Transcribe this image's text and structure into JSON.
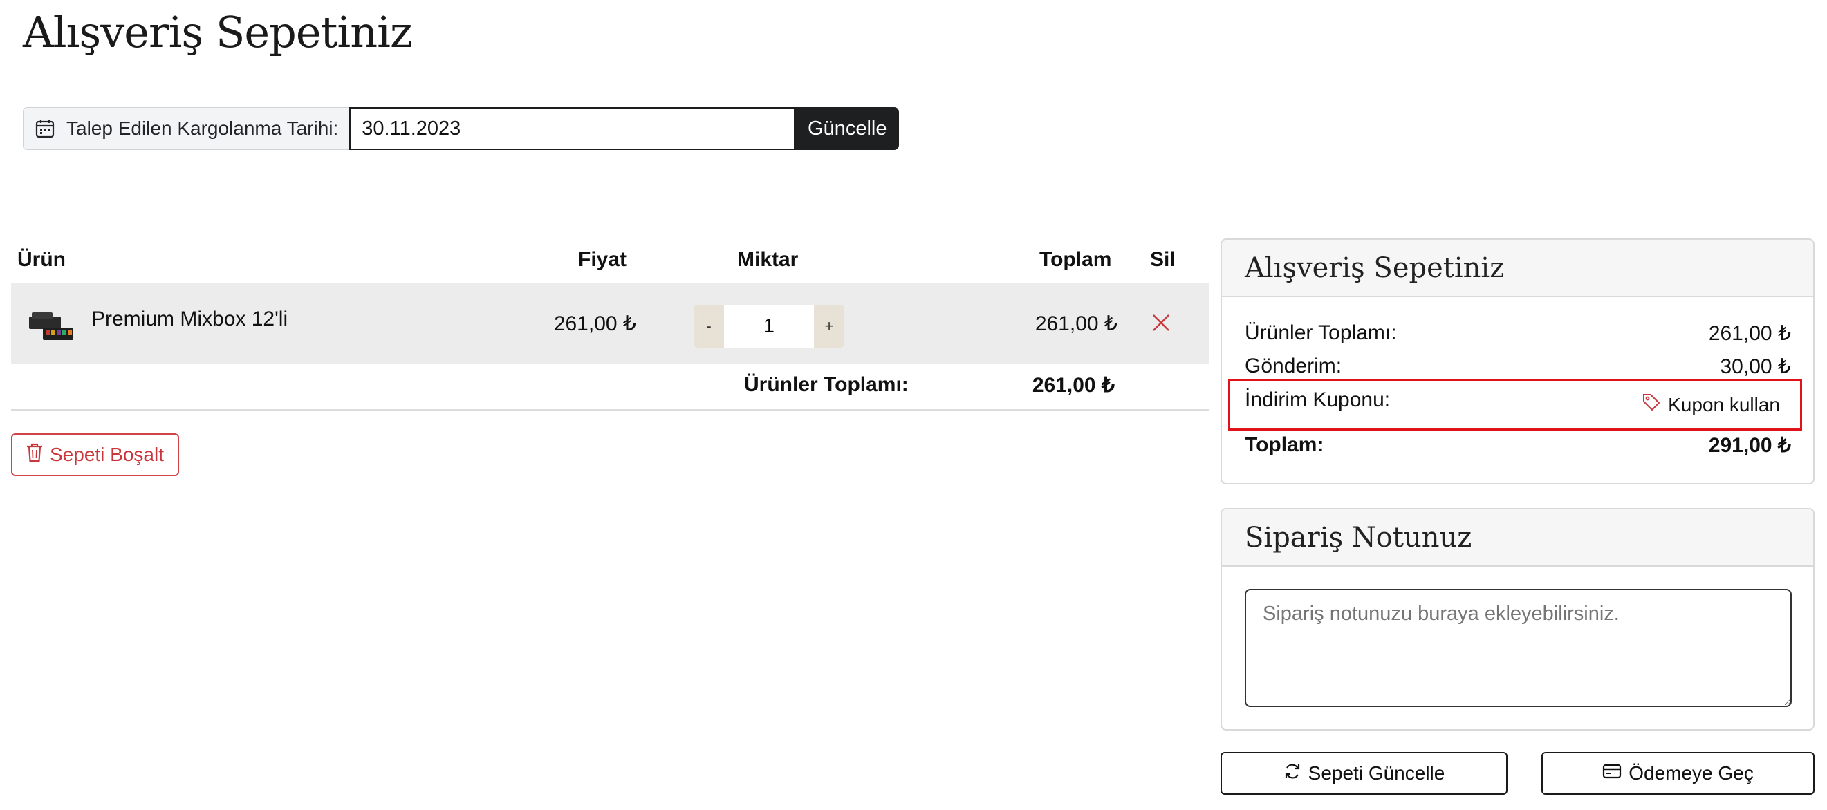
{
  "page": {
    "title": "Alışveriş Sepetiniz"
  },
  "date_bar": {
    "icon": "calendar-icon",
    "label": "Talep Edilen Kargolanma Tarihi:",
    "value": "30.11.2023",
    "button": "Güncelle"
  },
  "cart": {
    "headers": {
      "product": "Ürün",
      "price": "Fiyat",
      "quantity": "Miktar",
      "total": "Toplam",
      "delete": "Sil"
    },
    "items": [
      {
        "name": "Premium Mixbox 12'li",
        "price": "261,00 ₺",
        "quantity": "1",
        "total": "261,00 ₺",
        "decrement": "-",
        "increment": "+"
      }
    ],
    "subtotal_label": "Ürünler Toplamı:",
    "subtotal_value": "261,00 ₺",
    "empty_button": "Sepeti Boşalt",
    "empty_icon": "trash-icon"
  },
  "summary": {
    "title": "Alışveriş Sepetiniz",
    "products_label": "Ürünler Toplamı:",
    "products_value": "261,00 ₺",
    "shipping_label": "Gönderim:",
    "shipping_value": "30,00 ₺",
    "coupon_label": "İndirim Kuponu:",
    "coupon_link": "Kupon kullan",
    "coupon_icon": "tag-icon",
    "total_label": "Toplam:",
    "total_value": "291,00 ₺",
    "highlight_color": "#e0121a"
  },
  "note": {
    "title": "Sipariş Notunuz",
    "placeholder": "Sipariş notunuzu buraya ekleyebilirsiniz."
  },
  "actions": {
    "update_cart": "Sepeti Güncelle",
    "update_icon": "refresh-icon",
    "checkout": "Ödemeye Geç",
    "checkout_icon": "credit-card-icon"
  },
  "colors": {
    "danger": "#c9373d",
    "dark": "#1d1f21",
    "stepper": "#e8e2d6"
  }
}
